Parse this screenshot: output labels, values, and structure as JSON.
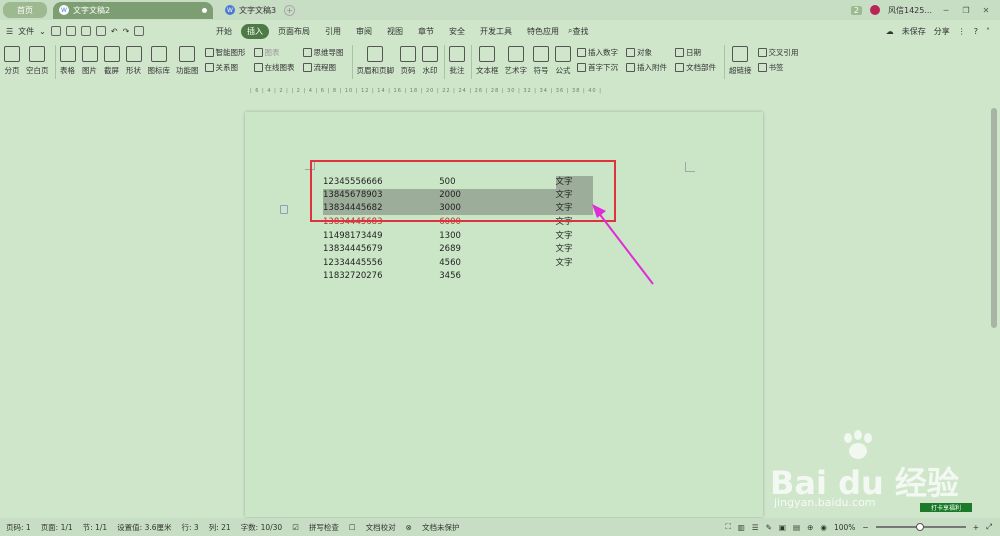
{
  "tabs": {
    "home": "首页",
    "doc_active": "文字文稿2",
    "doc_inactive": "文字文稿3",
    "badge": "2",
    "user": "风信1425..."
  },
  "menu": {
    "file": "文件",
    "items": [
      "开始",
      "插入",
      "页面布局",
      "引用",
      "审阅",
      "视图",
      "章节",
      "安全",
      "开发工具",
      "特色应用"
    ],
    "active": "插入",
    "search": "查找",
    "unsaved": "未保存",
    "share": "分享"
  },
  "ribbon": {
    "big": [
      "分页",
      "空白页",
      "表格",
      "图片",
      "截屏",
      "形状",
      "图标库",
      "功能图"
    ],
    "smart_shape": "智能图形",
    "chart": "图表",
    "mindmap": "思维导图",
    "relation": "关系图",
    "online_chart": "在线图表",
    "flowchart": "流程图",
    "header_footer": "页眉和页脚",
    "page_num": "页码",
    "watermark": "水印",
    "comment": "批注",
    "textbox": "文本框",
    "wordart": "艺术字",
    "symbol": "符号",
    "formula": "公式",
    "insert_number": "插入数字",
    "object": "对象",
    "date": "日期",
    "dropcap": "首字下沉",
    "attachment": "插入附件",
    "doc_parts": "文档部件",
    "hyperlink": "超链接",
    "crossref": "交叉引用",
    "bookmark": "书签"
  },
  "table_rows": [
    {
      "c1": "12345556666",
      "c2": "500",
      "c3": "文字"
    },
    {
      "c1": "13845678903",
      "c2": "2000",
      "c3": "文字"
    },
    {
      "c1": "13834445682",
      "c2": "3000",
      "c3": "文字"
    },
    {
      "c1": "13834445683",
      "c2": "6000",
      "c3": "文字"
    },
    {
      "c1": "11498173449",
      "c2": "1300",
      "c3": "文字"
    },
    {
      "c1": "13834445679",
      "c2": "2689",
      "c3": "文字"
    },
    {
      "c1": "12334445556",
      "c2": "4560",
      "c3": "文字"
    },
    {
      "c1": "11832720276",
      "c2": "3456",
      "c3": ""
    }
  ],
  "watermark": {
    "text": "Bai du 经验",
    "url": "jingyan.baidu.com",
    "badge": "打卡享福利"
  },
  "status": {
    "page": "页码: 1",
    "pages": "页面: 1/1",
    "section": "节: 1/1",
    "setting": "设置值: 3.6厘米",
    "line": "行: 3",
    "col": "列: 21",
    "words": "字数: 10/30",
    "spell": "拼写检查",
    "proof": "文档校对",
    "protect": "文档未保护",
    "zoom": "100%"
  },
  "colors": {
    "accent": "#4e7a46",
    "selection": "#9cae99",
    "highlight_box": "#e0323c",
    "arrow": "#e02bd8"
  }
}
